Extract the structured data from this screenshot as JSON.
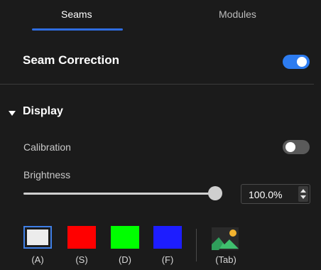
{
  "tabs": [
    {
      "label": "Seams",
      "active": true
    },
    {
      "label": "Modules",
      "active": false
    }
  ],
  "seam_correction": {
    "label": "Seam Correction",
    "enabled": true
  },
  "display": {
    "title": "Display",
    "calibration": {
      "label": "Calibration",
      "enabled": false
    },
    "brightness": {
      "label": "Brightness",
      "value": "100.0%",
      "level": 1.0
    }
  },
  "colors": {
    "accent": "#2d7cf0",
    "background": "#1b1b1b",
    "tab_indicator": "#2f6de0"
  },
  "swatches": [
    {
      "color": "#ececec",
      "label": "(A)",
      "selected": true
    },
    {
      "color": "#ff0000",
      "label": "(S)",
      "selected": false
    },
    {
      "color": "#00ff00",
      "label": "(D)",
      "selected": false
    },
    {
      "color": "#1d1dff",
      "label": "(F)",
      "selected": false
    }
  ],
  "image_option": {
    "icon": "image-icon",
    "label": "(Tab)"
  }
}
